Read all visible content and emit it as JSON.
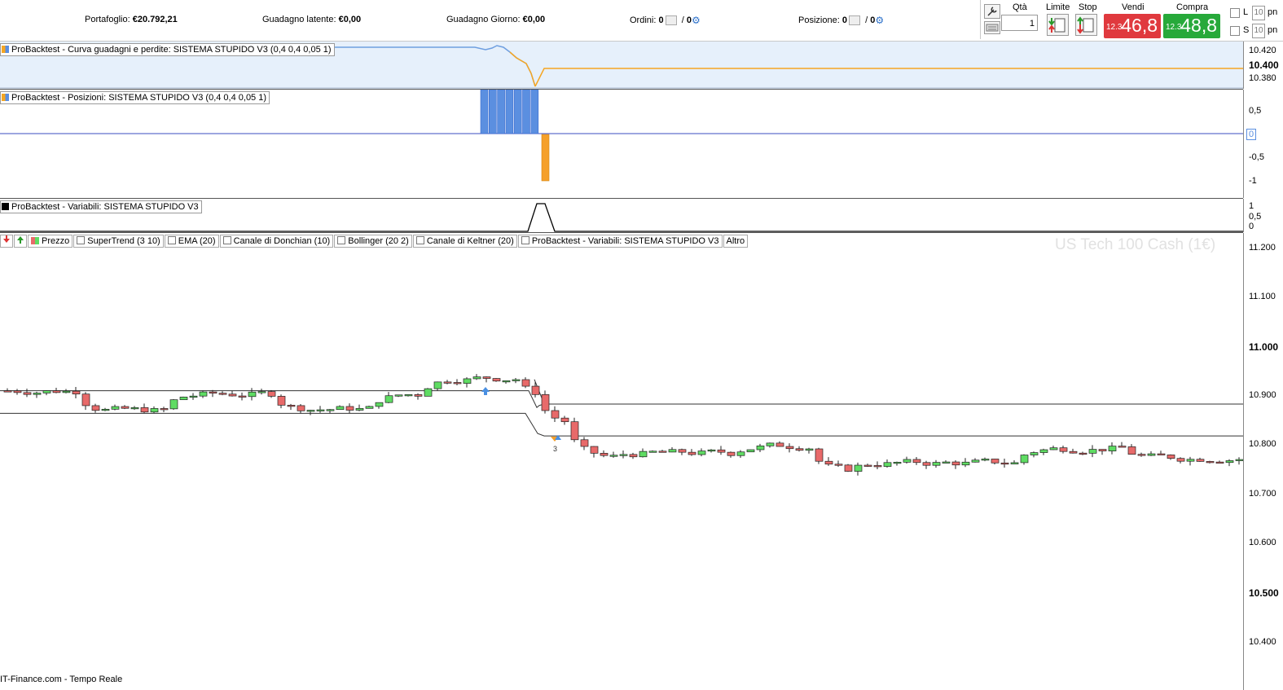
{
  "topbar": {
    "portfolio_label": "Portafoglio:",
    "portfolio_value": "€20.792,21",
    "unrealized_label": "Guadagno latente:",
    "unrealized_value": "€0,00",
    "daily_label": "Guadagno Giorno:",
    "daily_value": "€0,00",
    "orders_label": "Ordini:",
    "orders_count_a": "0",
    "orders_count_b": "0",
    "positions_label": "Posizione:",
    "positions_count_a": "0",
    "positions_count_b": "0"
  },
  "trade": {
    "qty_label": "Qtà",
    "qty_value": "1",
    "limit_label": "Limite",
    "stop_label": "Stop",
    "sell_label": "Vendi",
    "sell_small": "12.3",
    "sell_big": "46,8",
    "buy_label": "Compra",
    "buy_small": "12.3",
    "buy_big": "48,8",
    "l_label": "L",
    "s_label": "S",
    "l_value": "10",
    "s_value": "10",
    "l_unit": "pn",
    "s_unit": "pn",
    "sell_color": "#e0393e",
    "buy_color": "#27a93a"
  },
  "panels": {
    "equity_title": "ProBacktest - Curva guadagni e perdite: SISTEMA STUPIDO V3 (0,4 0,4 0,05 1)",
    "positions_title": "ProBacktest - Posizioni: SISTEMA STUPIDO V3 (0,4 0,4 0,05 1)",
    "variables_title": "ProBacktest - Variabili: SISTEMA STUPIDO V3"
  },
  "axes": {
    "equity": [
      "10.420",
      "10.400",
      "10.380"
    ],
    "positions": [
      "0,5",
      "0",
      "-0,5",
      "-1"
    ],
    "variables": [
      "1",
      "0,5",
      "0"
    ],
    "price": [
      "11.200",
      "11.100",
      "11.000",
      "10.900",
      "10.800",
      "10.700",
      "10.600",
      "10.500",
      "10.400"
    ]
  },
  "legend": {
    "price": "Prezzo",
    "items": [
      "SuperTrend (3 10)",
      "EMA (20)",
      "Canale di Donchian (10)",
      "Bollinger (20 2)",
      "Canale di Keltner (20)",
      "ProBacktest - Variabili: SISTEMA STUPIDO V3"
    ],
    "more": "Altro"
  },
  "watermark": "US Tech 100 Cash (1€)",
  "footer": "IT-Finance.com - Tempo Reale",
  "trade_marker_label": "3",
  "colors": {
    "up": "#5fdc63",
    "down": "#e86a6a",
    "equity_up": "#6f9fe0",
    "equity_down": "#f5a623",
    "pos_long": "#5b8fe0",
    "pos_short": "#f5a02a"
  }
}
